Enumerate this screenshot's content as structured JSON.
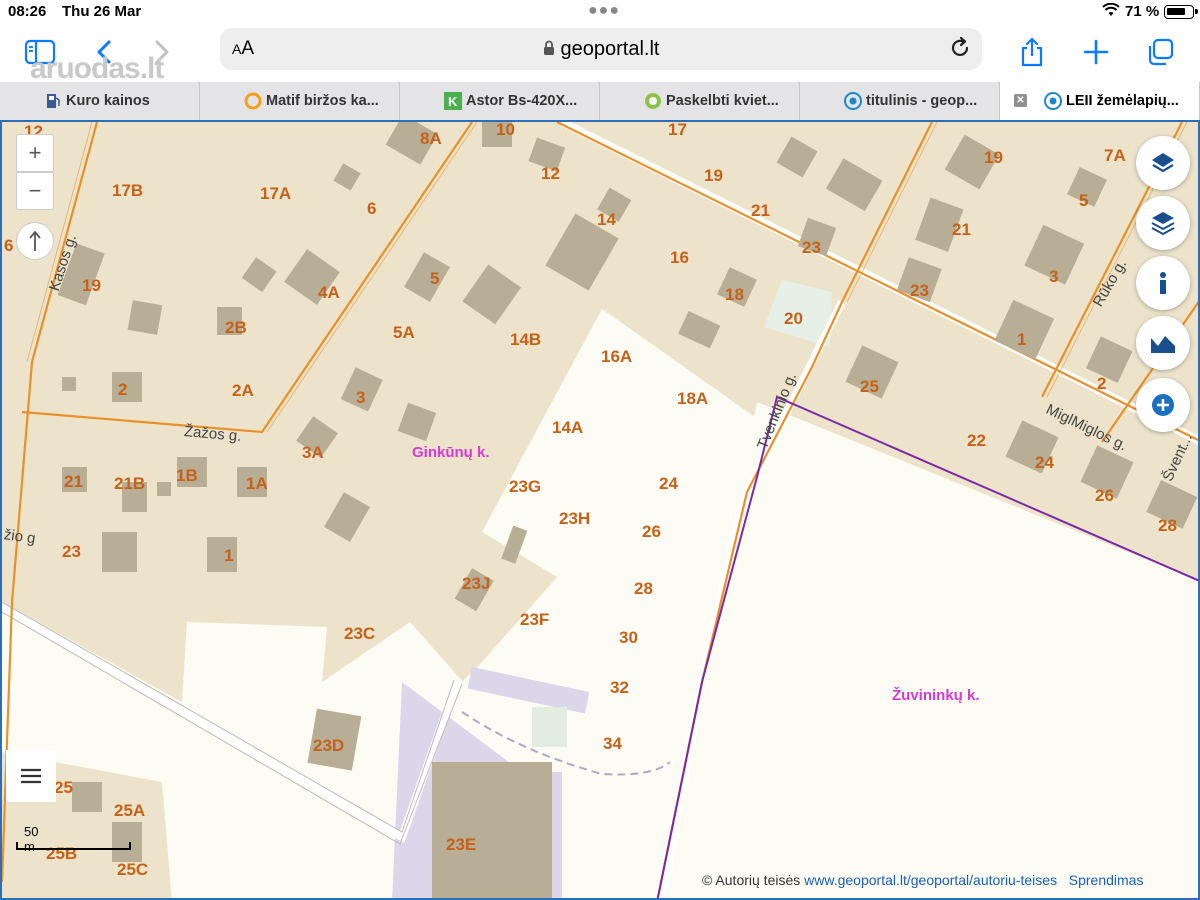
{
  "status_bar": {
    "time": "08:26",
    "date": "Thu 26 Mar",
    "battery": "71 %"
  },
  "toolbar": {
    "aa": "AA",
    "url": "geoportal.lt",
    "watermark": "aruodas.lt"
  },
  "tabs": [
    {
      "label": "Kuro kainos",
      "icon_color": "#3a5a9a",
      "icon": "fuel-icon"
    },
    {
      "label": "Matif biržos ka...",
      "icon_color": "#f0a01a",
      "icon": "diamond-icon"
    },
    {
      "label": "Astor Bs-420X...",
      "icon_color": "#4caf50",
      "icon": "k-icon"
    },
    {
      "label": "Paskelbti kviet...",
      "icon_color": "#8bc34a",
      "icon": "leaf-icon"
    },
    {
      "label": "titulinis - geop...",
      "icon_color": "#1e88c8",
      "icon": "geoportal-icon"
    },
    {
      "label": "LEII žemėlapių...",
      "icon_color": "#1e88c8",
      "icon": "geoportal-icon",
      "active": true
    }
  ],
  "map": {
    "parcel_labels": [
      "12",
      "8A",
      "10",
      "17",
      "19",
      "7A",
      "17B",
      "17A",
      "6",
      "12",
      "14",
      "19",
      "5",
      "21",
      "23",
      "21",
      "19",
      "4A",
      "5",
      "16",
      "18",
      "3",
      "23",
      "2B",
      "5A",
      "14B",
      "20",
      "1",
      "16A",
      "18A",
      "25",
      "2",
      "2A",
      "3",
      "2",
      "22",
      "24",
      "26",
      "28",
      "14A",
      "3A",
      "21",
      "21B",
      "1B",
      "1A",
      "23G",
      "24",
      "23H",
      "26",
      "23",
      "1",
      "23J",
      "28",
      "23F",
      "23C",
      "30",
      "32",
      "23D",
      "34",
      "25",
      "25A",
      "25B",
      "25C",
      "23E",
      "6"
    ],
    "streets": [
      "Kasos g.",
      "Žažos g.",
      "žio g",
      "Tvenkinio g.",
      "Miglos g.",
      "Migl",
      "Rūko g.",
      "Švent..."
    ],
    "villages": [
      "Ginkūnų k.",
      "Žuvininkų k."
    ],
    "scale_label": "50 m",
    "attribution_prefix": "© Autorių teisės",
    "attribution_link": "www.geoportal.lt/geoportal/autoriu-teises",
    "attribution_suffix": "Sprendimas",
    "zoom_in": "+",
    "zoom_out": "−"
  },
  "colors": {
    "land": "#ece3ca",
    "road": "#e8902a",
    "building": "#b8ad95",
    "boundary": "#7a2aa8",
    "label": "#c4621a",
    "village": "#d43ad4"
  }
}
